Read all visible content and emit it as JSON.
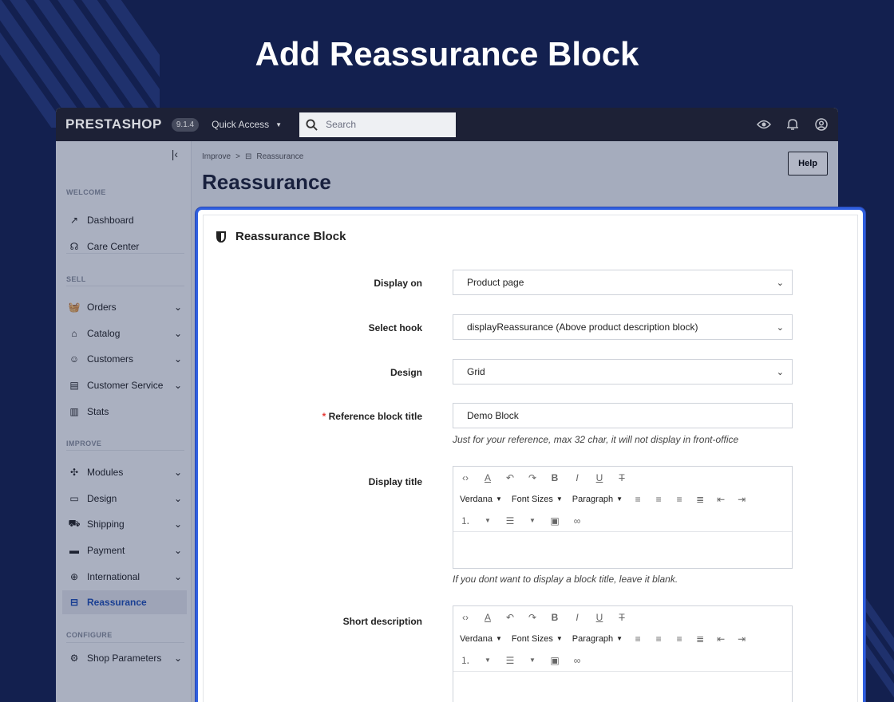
{
  "hero": {
    "title": "Add Reassurance Block"
  },
  "topbar": {
    "logo": "PRESTASHOP",
    "version": "9.1.4",
    "quick_access": "Quick Access",
    "search_placeholder": "Search"
  },
  "sidebar": {
    "sections": {
      "welcome": "WELCOME",
      "sell": "SELL",
      "improve": "IMPROVE",
      "configure": "CONFIGURE"
    },
    "items": {
      "dashboard": "Dashboard",
      "care_center": "Care Center",
      "orders": "Orders",
      "catalog": "Catalog",
      "customers": "Customers",
      "customer_service": "Customer Service",
      "stats": "Stats",
      "modules": "Modules",
      "design": "Design",
      "shipping": "Shipping",
      "payment": "Payment",
      "international": "International",
      "reassurance": "Reassurance",
      "shop_parameters": "Shop Parameters"
    }
  },
  "header": {
    "breadcrumb_parent": "Improve",
    "breadcrumb_sep": ">",
    "breadcrumb_current": "Reassurance",
    "title": "Reassurance",
    "help": "Help"
  },
  "form": {
    "title": "Reassurance Block",
    "display_on_label": "Display on",
    "display_on_value": "Product page",
    "hook_label": "Select hook",
    "hook_value": "displayReassurance (Above product description block)",
    "design_label": "Design",
    "design_value": "Grid",
    "ref_label": "Reference block title",
    "ref_required": "*",
    "ref_value": "Demo Block",
    "ref_hint": "Just for your reference, max 32 char, it will not display in front-office",
    "display_title_label": "Display title",
    "display_title_hint": "If you dont want to display a block title, leave it blank.",
    "short_desc_label": "Short description",
    "editor": {
      "font": "Verdana",
      "font_sizes": "Font Sizes",
      "paragraph": "Paragraph"
    }
  },
  "colors": {
    "accent": "#2f5fe0",
    "background": "#13204f",
    "topbar": "#1d2136"
  }
}
